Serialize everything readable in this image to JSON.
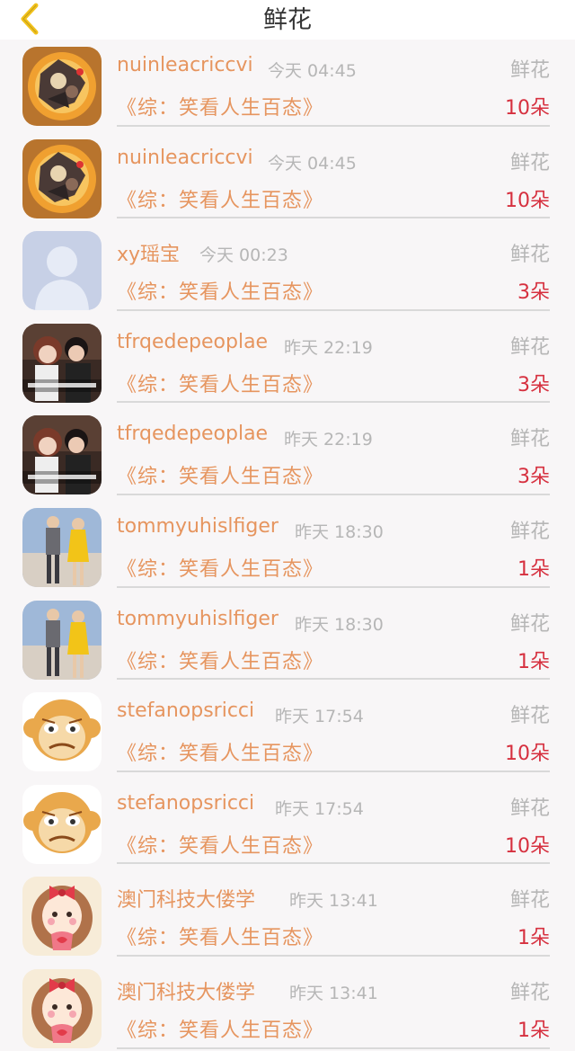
{
  "header": {
    "title": "鲜花",
    "back_icon": "chevron-left-icon",
    "back_color": "#f2c21b"
  },
  "colors": {
    "name": "#e6955f",
    "book": "#e6955f",
    "count": "#d6303f",
    "muted": "#b6b6b6"
  },
  "entries": [
    {
      "user": "nuinleacriccvi",
      "time": "今天 04:45",
      "gift": "鲜花",
      "book": "《综：笑看人生百态》",
      "count": "10朵",
      "avatar": "cartoon-orange"
    },
    {
      "user": "nuinleacriccvi",
      "time": "今天 04:45",
      "gift": "鲜花",
      "book": "《综：笑看人生百态》",
      "count": "10朵",
      "avatar": "cartoon-orange"
    },
    {
      "user": "xy瑶宝",
      "time": "今天 00:23",
      "gift": "鲜花",
      "book": "《综：笑看人生百态》",
      "count": "3朵",
      "avatar": "default"
    },
    {
      "user": "tfrqedepeoplae",
      "time": "昨天 22:19",
      "gift": "鲜花",
      "book": "《综：笑看人生百态》",
      "count": "3朵",
      "avatar": "couple-photo"
    },
    {
      "user": "tfrqedepeoplae",
      "time": "昨天 22:19",
      "gift": "鲜花",
      "book": "《综：笑看人生百态》",
      "count": "3朵",
      "avatar": "couple-photo"
    },
    {
      "user": "tommyuhislfiger",
      "time": "昨天 18:30",
      "gift": "鲜花",
      "book": "《综：笑看人生百态》",
      "count": "1朵",
      "avatar": "fashion-photo"
    },
    {
      "user": "tommyuhislfiger",
      "time": "昨天 18:30",
      "gift": "鲜花",
      "book": "《综：笑看人生百态》",
      "count": "1朵",
      "avatar": "fashion-photo"
    },
    {
      "user": "stefanopsricci",
      "time": "昨天 17:54",
      "gift": "鲜花",
      "book": "《综：笑看人生百态》",
      "count": "10朵",
      "avatar": "monkey"
    },
    {
      "user": "stefanopsricci",
      "time": "昨天 17:54",
      "gift": "鲜花",
      "book": "《综：笑看人生百态》",
      "count": "10朵",
      "avatar": "monkey"
    },
    {
      "user": "澳门科技大偻学",
      "time": "昨天 13:41",
      "gift": "鲜花",
      "book": "《综：笑看人生百态》",
      "count": "1朵",
      "avatar": "girl-bow"
    },
    {
      "user": "澳门科技大偻学",
      "time": "昨天 13:41",
      "gift": "鲜花",
      "book": "《综：笑看人生百态》",
      "count": "1朵",
      "avatar": "girl-bow"
    }
  ]
}
